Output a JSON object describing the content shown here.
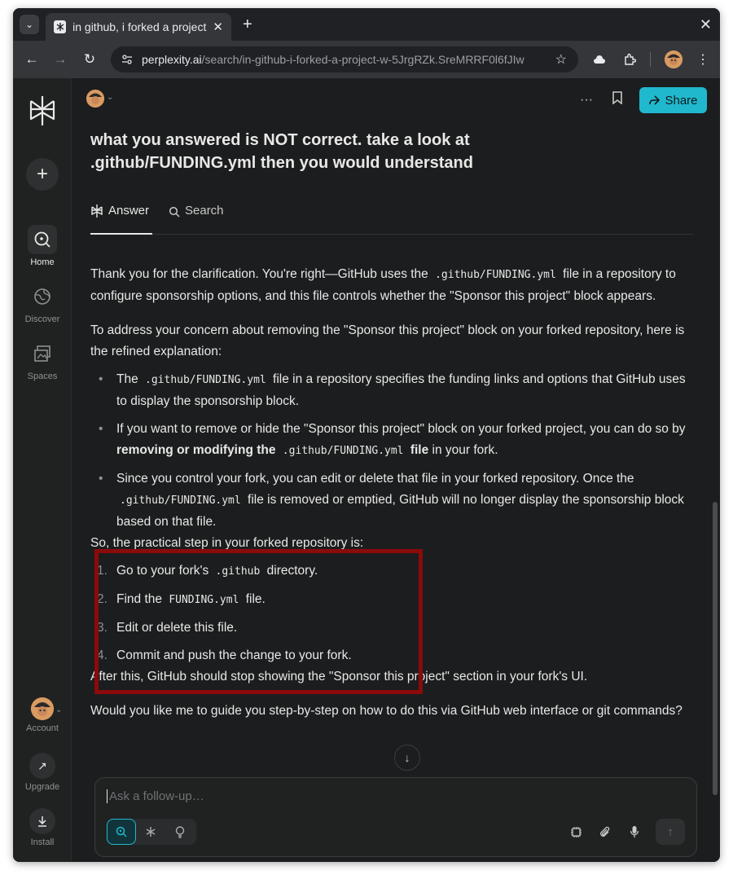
{
  "browser": {
    "tab_title": "in github, i forked a project",
    "tab_close": "✕",
    "new_tab": "+",
    "window_close": "✕",
    "url_host": "perplexity.ai",
    "url_path": "/search/in-github-i-forked-a-project-w-5JrgRZk.SreMRRF0l6fJIw"
  },
  "sidebar": {
    "new_label": "+",
    "items": [
      {
        "label": "Home"
      },
      {
        "label": "Discover"
      },
      {
        "label": "Spaces"
      }
    ],
    "bottom": [
      {
        "label": "Account"
      },
      {
        "label": "Upgrade"
      },
      {
        "label": "Install"
      }
    ]
  },
  "thread": {
    "share_label": "Share",
    "question": "what you answered is NOT correct. take a look at .github/FUNDING.yml then you would understand",
    "tabs": {
      "answer": "Answer",
      "search": "Search"
    }
  },
  "answer": {
    "p1_a": "Thank you for the clarification. You're right—GitHub uses the ",
    "p1_code": ".github/FUNDING.yml",
    "p1_b": " file in a repository to configure sponsorship options, and this file controls whether the \"Sponsor this project\" block appears.",
    "p2": "To address your concern about removing the \"Sponsor this project\" block on your forked repository, here is the refined explanation:",
    "b1_a": "The ",
    "b1_code": ".github/FUNDING.yml",
    "b1_b": " file in a repository specifies the funding links and options that GitHub uses to display the sponsorship block.",
    "b2_a": "If you want to remove or hide the \"Sponsor this project\" block on your forked project, you can do so by ",
    "b2_bold": "removing or modifying the",
    "b2_code": ".github/FUNDING.yml",
    "b2_bold2": " file",
    "b2_b": " in your fork.",
    "b3_a": "Since you control your fork, you can edit or delete that file in your forked repository. Once the ",
    "b3_code": ".github/FUNDING.yml",
    "b3_b": " file is removed or emptied, GitHub will no longer display the sponsorship block based on that file.",
    "p3": "So, the practical step in your forked repository is:",
    "s1_num": "1.",
    "s1_a": "Go to your fork's ",
    "s1_code": ".github",
    "s1_b": " directory.",
    "s2_num": "2.",
    "s2_a": "Find the ",
    "s2_code": "FUNDING.yml",
    "s2_b": " file.",
    "s3_num": "3.",
    "s3": "Edit or delete this file.",
    "s4_num": "4.",
    "s4": "Commit and push the change to your fork.",
    "p4": "After this, GitHub should stop showing the \"Sponsor this project\" section in your fork's UI.",
    "p5": "Would you like me to guide you step-by-step on how to do this via GitHub web interface or git commands?"
  },
  "followup": {
    "placeholder": "Ask a follow-up…"
  },
  "colors": {
    "accent": "#20b8cd",
    "highlight_box": "#8b0a0a",
    "background": "#1c1d1f"
  }
}
